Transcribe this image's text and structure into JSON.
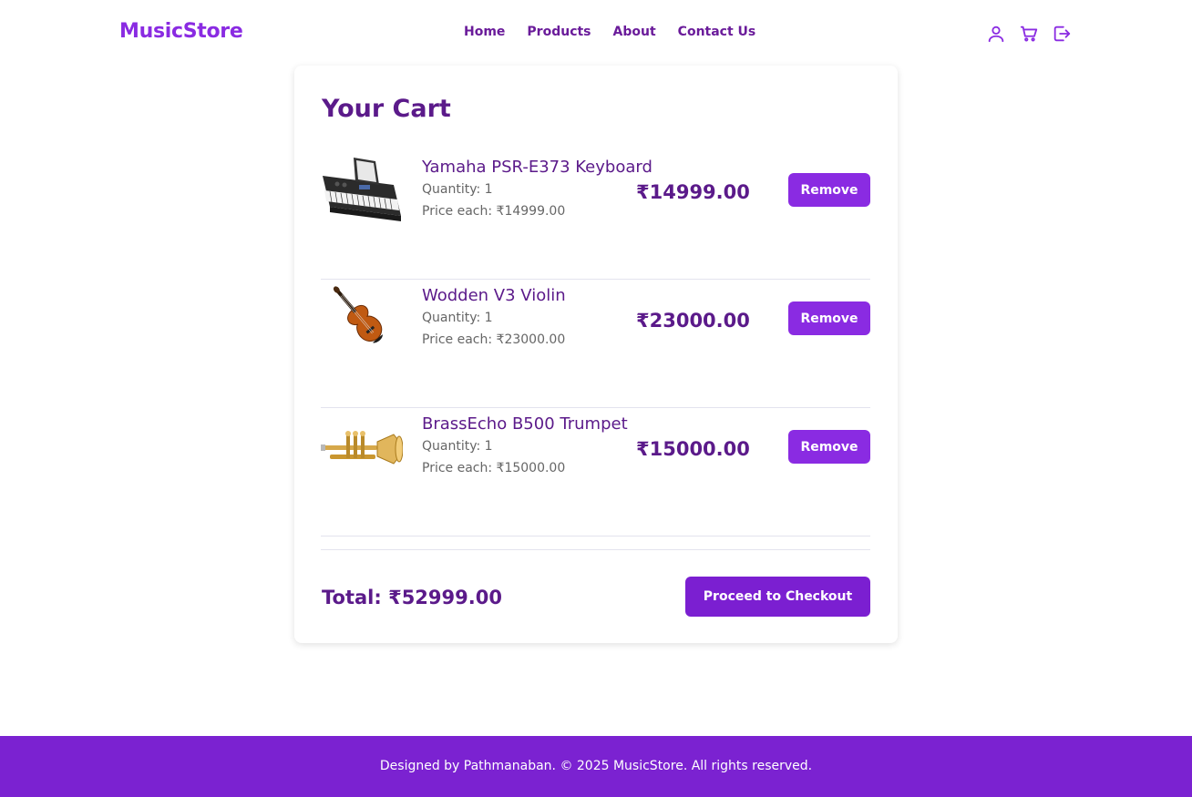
{
  "nav": {
    "brand": "MusicStore",
    "links": [
      "Home",
      "Products",
      "About",
      "Contact Us"
    ],
    "icons": [
      "user-icon",
      "cart-icon",
      "logout-icon"
    ]
  },
  "cart": {
    "title": "Your Cart",
    "items": [
      {
        "name": "Yamaha PSR-E373 Keyboard",
        "quantity_text": "Quantity: 1",
        "price_each_text": "Price each: ₹14999.00",
        "subtotal": "₹14999.00",
        "remove_label": "Remove",
        "image_icon": "keyboard-image"
      },
      {
        "name": "Wodden V3 Violin",
        "quantity_text": "Quantity: 1",
        "price_each_text": "Price each: ₹23000.00",
        "subtotal": "₹23000.00",
        "remove_label": "Remove",
        "image_icon": "violin-image"
      },
      {
        "name": "BrassEcho B500 Trumpet",
        "quantity_text": "Quantity: 1",
        "price_each_text": "Price each: ₹15000.00",
        "subtotal": "₹15000.00",
        "remove_label": "Remove",
        "image_icon": "trumpet-image"
      }
    ],
    "total_text": "Total: ₹52999.00",
    "checkout_label": "Proceed to Checkout"
  },
  "footer": {
    "text": "Designed by Pathmanaban. © 2025 MusicStore. All rights reserved."
  },
  "colors": {
    "brand": "#8a2be2",
    "accent": "#7b1fd1",
    "heading": "#5b1a8a",
    "footer_bg": "#7b22d1"
  }
}
